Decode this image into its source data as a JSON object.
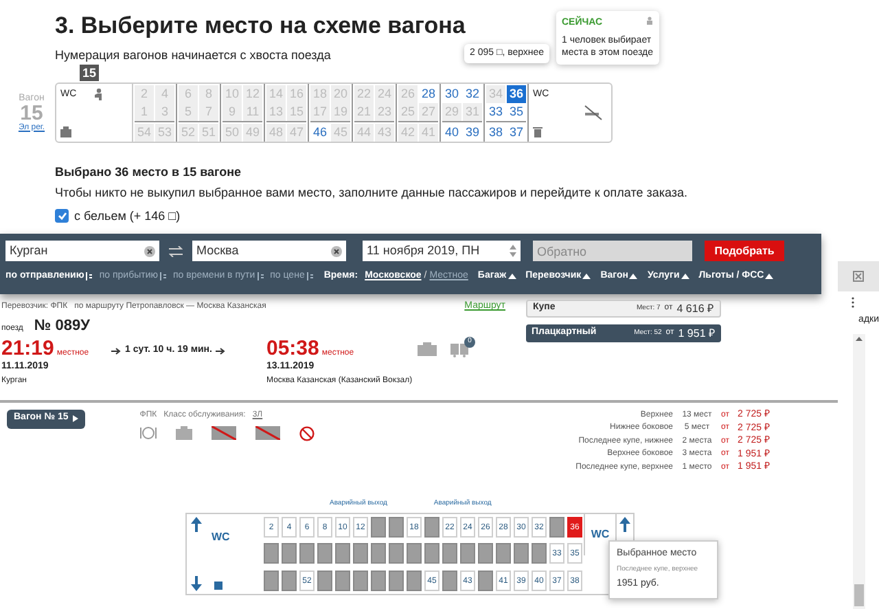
{
  "step": {
    "title": "3. Выберите место на схеме вагона",
    "note": "Нумерация вагонов начинается с хвоста поезда"
  },
  "now_popup": {
    "title": "СЕЙЧАС",
    "text": "1 человек выбирает места в этом поезде"
  },
  "seat_tooltip": "2 095 □, верхнее",
  "top_scheme": {
    "car_label": "Вагон",
    "car_number": "15",
    "car_type": "Эл рег.",
    "badge": "15",
    "wc_left": "WC",
    "wc_right": "WC",
    "compartments": [
      {
        "upper": [
          {
            "number": "2",
            "free": false,
            "selected": false
          },
          {
            "number": "4",
            "free": false,
            "selected": false
          }
        ],
        "lower": [
          {
            "number": "1",
            "free": false,
            "selected": false
          },
          {
            "number": "3",
            "free": false,
            "selected": false
          }
        ],
        "side": [
          {
            "number": "54",
            "free": false,
            "selected": false
          },
          {
            "number": "53",
            "free": false,
            "selected": false
          }
        ]
      },
      {
        "upper": [
          {
            "number": "6",
            "free": false,
            "selected": false
          },
          {
            "number": "8",
            "free": false,
            "selected": false
          }
        ],
        "lower": [
          {
            "number": "5",
            "free": false,
            "selected": false
          },
          {
            "number": "7",
            "free": false,
            "selected": false
          }
        ],
        "side": [
          {
            "number": "52",
            "free": false,
            "selected": false
          },
          {
            "number": "51",
            "free": false,
            "selected": false
          }
        ]
      },
      {
        "upper": [
          {
            "number": "10",
            "free": false,
            "selected": false
          },
          {
            "number": "12",
            "free": false,
            "selected": false
          }
        ],
        "lower": [
          {
            "number": "9",
            "free": false,
            "selected": false
          },
          {
            "number": "11",
            "free": false,
            "selected": false
          }
        ],
        "side": [
          {
            "number": "50",
            "free": false,
            "selected": false
          },
          {
            "number": "49",
            "free": false,
            "selected": false
          }
        ]
      },
      {
        "upper": [
          {
            "number": "14",
            "free": false,
            "selected": false
          },
          {
            "number": "16",
            "free": false,
            "selected": false
          }
        ],
        "lower": [
          {
            "number": "13",
            "free": false,
            "selected": false
          },
          {
            "number": "15",
            "free": false,
            "selected": false
          }
        ],
        "side": [
          {
            "number": "48",
            "free": false,
            "selected": false
          },
          {
            "number": "47",
            "free": false,
            "selected": false
          }
        ]
      },
      {
        "upper": [
          {
            "number": "18",
            "free": false,
            "selected": false
          },
          {
            "number": "20",
            "free": false,
            "selected": false
          }
        ],
        "lower": [
          {
            "number": "17",
            "free": false,
            "selected": false
          },
          {
            "number": "19",
            "free": false,
            "selected": false
          }
        ],
        "side": [
          {
            "number": "46",
            "free": true,
            "selected": false
          },
          {
            "number": "45",
            "free": false,
            "selected": false
          }
        ]
      },
      {
        "upper": [
          {
            "number": "22",
            "free": false,
            "selected": false
          },
          {
            "number": "24",
            "free": false,
            "selected": false
          }
        ],
        "lower": [
          {
            "number": "21",
            "free": false,
            "selected": false
          },
          {
            "number": "23",
            "free": false,
            "selected": false
          }
        ],
        "side": [
          {
            "number": "44",
            "free": false,
            "selected": false
          },
          {
            "number": "43",
            "free": false,
            "selected": false
          }
        ]
      },
      {
        "upper": [
          {
            "number": "26",
            "free": false,
            "selected": false
          },
          {
            "number": "28",
            "free": true,
            "selected": false
          }
        ],
        "lower": [
          {
            "number": "25",
            "free": false,
            "selected": false
          },
          {
            "number": "27",
            "free": false,
            "selected": false
          }
        ],
        "side": [
          {
            "number": "42",
            "free": false,
            "selected": false
          },
          {
            "number": "41",
            "free": false,
            "selected": false
          }
        ]
      },
      {
        "upper": [
          {
            "number": "30",
            "free": true,
            "selected": false
          },
          {
            "number": "32",
            "free": true,
            "selected": false
          }
        ],
        "lower": [
          {
            "number": "29",
            "free": false,
            "selected": false
          },
          {
            "number": "31",
            "free": false,
            "selected": false
          }
        ],
        "side": [
          {
            "number": "40",
            "free": true,
            "selected": false
          },
          {
            "number": "39",
            "free": true,
            "selected": false
          }
        ]
      },
      {
        "upper": [
          {
            "number": "34",
            "free": false,
            "selected": false
          },
          {
            "number": "36",
            "selected": true
          }
        ],
        "lower": [
          {
            "number": "33",
            "free": true,
            "selected": false
          },
          {
            "number": "35",
            "free": true,
            "selected": false
          }
        ],
        "side": [
          {
            "number": "38",
            "free": true,
            "selected": false
          },
          {
            "number": "37",
            "free": true,
            "selected": false
          }
        ]
      }
    ]
  },
  "selection": {
    "title": "Выбрано 36 место в 15 вагоне",
    "text": "Чтобы никто не выкупил выбранное вами место, заполните данные пассажиров и перейдите к оплате заказа.",
    "linen": {
      "label": "с бельем (+ 146 □)",
      "checked": true
    }
  },
  "search": {
    "from": "Курган",
    "to": "Москва",
    "date": "11 ноября 2019, ПН",
    "return_placeholder": "Обратно",
    "submit": "Подобрать"
  },
  "sort": [
    {
      "label": "по отправлению",
      "selected": true
    },
    {
      "label": "по прибытию",
      "selected": false
    },
    {
      "label": "по времени в пути",
      "selected": false
    },
    {
      "label": "по цене",
      "selected": false
    }
  ],
  "time": {
    "label": "Время:",
    "options": [
      {
        "label": "Московское",
        "selected": true
      },
      {
        "label": "Местное",
        "selected": false
      }
    ],
    "separator": "/"
  },
  "filters": [
    "Багаж",
    "Перевозчик",
    "Вагон",
    "Услуги",
    "Льготы / ФСС"
  ],
  "train": {
    "carrier": "Перевозчик: ФПК",
    "route": "по маршруту Петропавловск — Москва Казанская",
    "route_link": "Маршрут",
    "number_label": "поезд",
    "number": "№ 089У",
    "departure": {
      "time": "21:19",
      "zone": "местное",
      "date": "11.11.2019",
      "station": "Курган"
    },
    "duration": "1 сут. 10 ч. 19 мин.",
    "arrival": {
      "time": "05:38",
      "zone": "местное",
      "date": "13.11.2019",
      "station": "Москва Казанская (Казанский Вокзал)"
    },
    "cars_badge": "0"
  },
  "classes": [
    {
      "name": "Купе",
      "seats": "Мест: 7",
      "from": "от",
      "price": "4 616 ₽",
      "selected": false
    },
    {
      "name": "Плацкартный",
      "seats": "Мест: 52",
      "from": "от",
      "price": "1 951 ₽",
      "selected": true
    }
  ],
  "side_text": "адки",
  "car_button": "Вагон № 15",
  "service": {
    "carrier": "ФПК",
    "class_label": "Класс обслуживания:",
    "class": "3Л"
  },
  "prices": [
    {
      "label": "Верхнее",
      "count": "13 мест",
      "from": "от",
      "price": "2 725 ₽"
    },
    {
      "label": "Нижнее боковое",
      "count": "5 мест",
      "from": "от",
      "price": "2 725 ₽"
    },
    {
      "label": "Последнее купе, нижнее",
      "count": "2 места",
      "from": "от",
      "price": "2 725 ₽"
    },
    {
      "label": "Верхнее боковое",
      "count": "3 места",
      "from": "от",
      "price": "1 951 ₽"
    },
    {
      "label": "Последнее купе, верхнее",
      "count": "1 место",
      "from": "от",
      "price": "1 951 ₽"
    }
  ],
  "bottom_scheme": {
    "exits": [
      "Аварийный выход",
      "Аварийный выход"
    ],
    "wc_left": "WC",
    "wc_right": "WC",
    "compartments": [
      {
        "upper": [
          {
            "number": "2",
            "free": true,
            "selected": false
          },
          {
            "number": "4",
            "free": true,
            "selected": false
          }
        ],
        "lower": [
          {
            "free": false,
            "selected": false
          },
          {
            "free": false,
            "selected": false
          }
        ],
        "side": [
          {
            "free": false,
            "selected": false
          },
          {
            "free": false,
            "selected": false
          }
        ]
      },
      {
        "upper": [
          {
            "number": "6",
            "free": true,
            "selected": false
          },
          {
            "number": "8",
            "free": true,
            "selected": false
          }
        ],
        "lower": [
          {
            "free": false,
            "selected": false
          },
          {
            "free": false,
            "selected": false
          }
        ],
        "side": [
          {
            "number": "52",
            "free": true,
            "selected": false
          },
          {
            "free": false,
            "selected": false
          }
        ]
      },
      {
        "upper": [
          {
            "number": "10",
            "free": true,
            "selected": false
          },
          {
            "number": "12",
            "free": true,
            "selected": false
          }
        ],
        "lower": [
          {
            "free": false,
            "selected": false
          },
          {
            "free": false,
            "selected": false
          }
        ],
        "side": [
          {
            "free": false,
            "selected": false
          },
          {
            "free": false,
            "selected": false
          }
        ]
      },
      {
        "upper": [
          {
            "free": false,
            "selected": false
          },
          {
            "free": false,
            "selected": false
          }
        ],
        "lower": [
          {
            "free": false,
            "selected": false
          },
          {
            "free": false,
            "selected": false
          }
        ],
        "side": [
          {
            "free": false,
            "selected": false
          },
          {
            "free": false,
            "selected": false
          }
        ]
      },
      {
        "upper": [
          {
            "number": "18",
            "free": true,
            "selected": false
          },
          {
            "free": false,
            "selected": false
          }
        ],
        "lower": [
          {
            "free": false,
            "selected": false
          },
          {
            "free": false,
            "selected": false
          }
        ],
        "side": [
          {
            "free": false,
            "selected": false
          },
          {
            "number": "45",
            "free": true,
            "selected": false
          }
        ]
      },
      {
        "upper": [
          {
            "number": "22",
            "free": true,
            "selected": false
          },
          {
            "number": "24",
            "free": true,
            "selected": false
          }
        ],
        "lower": [
          {
            "free": false,
            "selected": false
          },
          {
            "free": false,
            "selected": false
          }
        ],
        "side": [
          {
            "free": false,
            "selected": false
          },
          {
            "number": "43",
            "free": true,
            "selected": false
          }
        ]
      },
      {
        "upper": [
          {
            "number": "26",
            "free": true,
            "selected": false
          },
          {
            "number": "28",
            "free": true,
            "selected": false
          }
        ],
        "lower": [
          {
            "free": false,
            "selected": false
          },
          {
            "free": false,
            "selected": false
          }
        ],
        "side": [
          {
            "free": false,
            "selected": false
          },
          {
            "number": "41",
            "free": true,
            "selected": false
          }
        ]
      },
      {
        "upper": [
          {
            "number": "30",
            "free": true,
            "selected": false
          },
          {
            "number": "32",
            "free": true,
            "selected": false
          }
        ],
        "lower": [
          {
            "free": false,
            "selected": false
          },
          {
            "free": false,
            "selected": false
          }
        ],
        "side": [
          {
            "number": "39",
            "free": true,
            "selected": false
          },
          {
            "number": "40",
            "free": true,
            "selected": false
          }
        ]
      },
      {
        "upper": [
          {
            "free": false,
            "selected": false
          },
          {
            "number": "36",
            "selected": true
          }
        ],
        "lower": [
          {
            "number": "33",
            "free": true,
            "selected": false
          },
          {
            "number": "35",
            "free": true,
            "selected": false
          }
        ],
        "side": [
          {
            "number": "37",
            "free": true,
            "selected": false
          },
          {
            "number": "38",
            "free": true,
            "selected": false
          }
        ]
      }
    ]
  },
  "selected_tooltip": {
    "title": "Выбранное место",
    "subtitle": "Последнее купе, верхнее",
    "price": "1951 руб."
  }
}
